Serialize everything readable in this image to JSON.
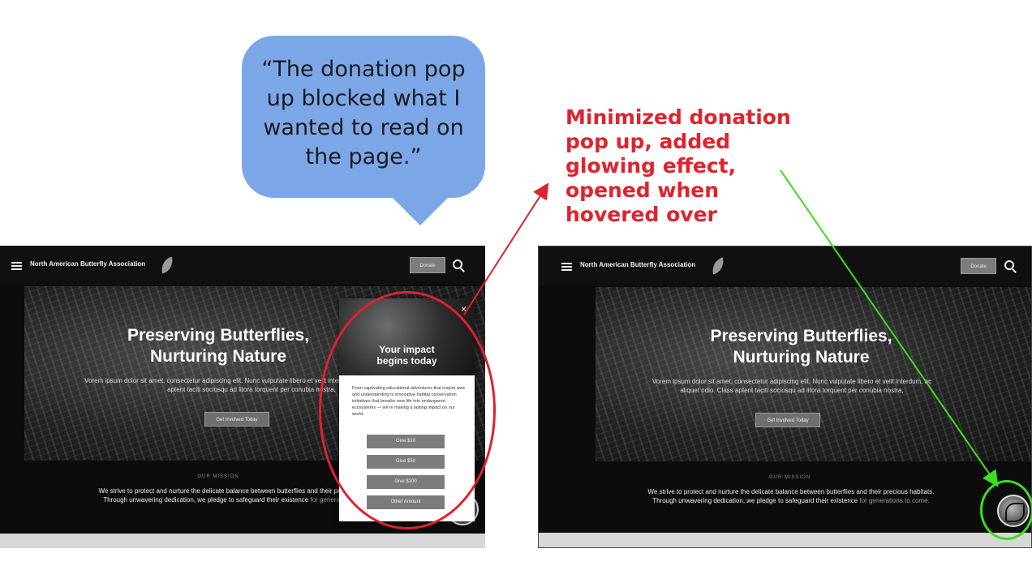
{
  "bubble": {
    "quote": "“The donation pop up blocked what I wanted to read on the page.”"
  },
  "annotation": {
    "text": "Minimized donation pop up, added glowing effect, opened when hovered over",
    "color": "#e0222d"
  },
  "site": {
    "brand": "North American Butterfly Association",
    "donate_label": "Donate",
    "hero_title_line1": "Preserving Butterflies,",
    "hero_title_line2": "Nurturing Nature",
    "hero_body": "Vorem ipsum dolor sit amet, consectetur adipiscing elit. Nunc vulputate libero et velit interdum, ac aliquet odio. Class aptent taciti sociosqu ad litora torquent per conubia nostra,",
    "cta_label": "Get Involved Today",
    "mission_label": "OUR MISSION",
    "mission_text": "We strive to protect and nurture the delicate balance between butterflies and their precious habitats. Through unwavering dedication, we pledge to safeguard their existence",
    "mission_text_dim": "for generations to come."
  },
  "popup": {
    "close": "×",
    "title_line1": "Your impact",
    "title_line2": "begins today",
    "body": "From captivating educational adventures that inspire awe and understanding to innovative habitat conservation initiatives that breathe new life into endangered ecosystems — we're making a lasting impact on our world.",
    "buttons": [
      "Give $10",
      "Give $50",
      "Give $100",
      "Other Amount"
    ]
  },
  "colors": {
    "bubble": "#7ba7e8",
    "ring_red": "#e0222d",
    "ring_green": "#3fdc1f"
  }
}
